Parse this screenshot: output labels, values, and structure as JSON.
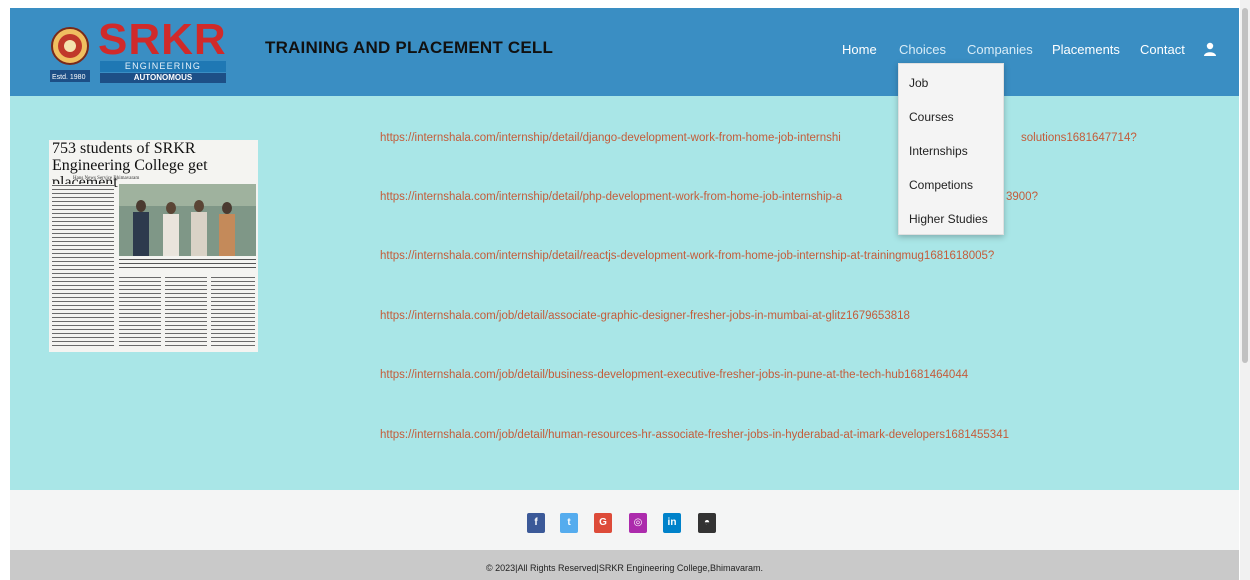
{
  "logo": {
    "word": "SRKR",
    "subtitle": "ENGINEERING COLLEGE",
    "autonomous": "AUTONOMOUS",
    "estd": "Estd. 1980"
  },
  "site_title": "TRAINING AND PLACEMENT CELL",
  "nav": {
    "home": "Home",
    "choices": "Choices",
    "companies": "Companies",
    "placements": "Placements",
    "contact": "Contact",
    "user_icon": "user-icon"
  },
  "dropdown": [
    "Job",
    "Courses",
    "Internships",
    "Competions",
    "Higher Studies"
  ],
  "newspaper": {
    "headline": "753 students of SRKR Engineering College get placement",
    "byline": "Hans News Service Bhimavaram"
  },
  "links": [
    "https://internshala.com/internship/detail/django-development-work-from-home-job-internshi",
    "solutions1681647714?",
    "https://internshala.com/internship/detail/php-development-work-from-home-job-internship-a",
    "3900?",
    "https://internshala.com/internship/detail/reactjs-development-work-from-home-job-internship-at-trainingmug1681618005?",
    "https://internshala.com/job/detail/associate-graphic-designer-fresher-jobs-in-mumbai-at-glitz1679653818",
    "https://internshala.com/job/detail/business-development-executive-fresher-jobs-in-pune-at-the-tech-hub1681464044",
    "https://internshala.com/job/detail/human-resources-hr-associate-fresher-jobs-in-hyderabad-at-imark-developers1681455341"
  ],
  "social": [
    {
      "icon": "facebook-icon",
      "glyph": "f",
      "color": "#3b5998"
    },
    {
      "icon": "twitter-icon",
      "glyph": "t",
      "color": "#55acee"
    },
    {
      "icon": "google-icon",
      "glyph": "G",
      "color": "#dd4b39"
    },
    {
      "icon": "instagram-icon",
      "glyph": "◎",
      "color": "#ac2bac"
    },
    {
      "icon": "linkedin-icon",
      "glyph": "in",
      "color": "#0082ca"
    },
    {
      "icon": "github-icon",
      "glyph": "◓",
      "color": "#333333"
    }
  ],
  "footer": {
    "copyright": "© 2023|All Rights Reserved|SRKR Engineering College,Bhimavaram."
  },
  "colors": {
    "header": "#3a8ec3",
    "content_bg": "#a9e6e7",
    "link": "#c45c3a",
    "logo_red": "#d02a2a"
  }
}
